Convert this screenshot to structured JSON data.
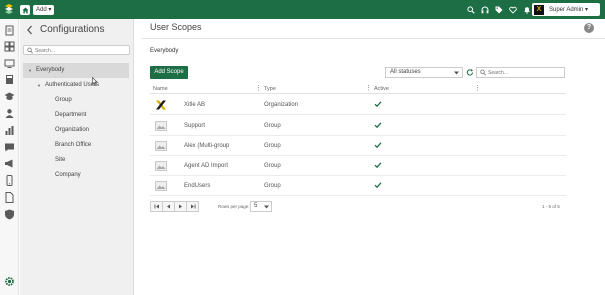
{
  "topbar": {
    "add_label": "Add ▾",
    "user_name": "Super Admin ▾"
  },
  "config": {
    "title": "Configurations",
    "search_placeholder": "Search...",
    "tree": {
      "root": "Everybody",
      "child": "Authenticated Users",
      "leaves": [
        "Group",
        "Department",
        "Organization",
        "Branch Office",
        "Site",
        "Company"
      ]
    }
  },
  "main": {
    "title": "User Scopes",
    "section": "Everybody",
    "add_button": "Add Scope",
    "status_filter": "All statuses",
    "search_placeholder": "Search...",
    "columns": [
      "Name",
      "Type",
      "Active"
    ],
    "rows": [
      {
        "name": "Xitle AB",
        "type": "Organization",
        "active": true,
        "icon": "brand-x-logo"
      },
      {
        "name": "Support",
        "type": "Group",
        "active": true,
        "icon": "image-placeholder-icon"
      },
      {
        "name": "Alex (Multi-group",
        "type": "Group",
        "active": true,
        "icon": "image-placeholder-icon"
      },
      {
        "name": "Agent AD Import",
        "type": "Group",
        "active": true,
        "icon": "image-placeholder-icon"
      },
      {
        "name": "EndUsers",
        "type": "Group",
        "active": true,
        "icon": "image-placeholder-icon"
      }
    ],
    "pagination": {
      "rows_per_page_label": "Rows per page:",
      "rows_per_page_value": "5",
      "count_text": "1 - 5 of 5"
    }
  },
  "colors": {
    "brand_green": "#1e6e45",
    "check_green": "#1e6e45",
    "selection_gray": "#d9d9d9"
  }
}
